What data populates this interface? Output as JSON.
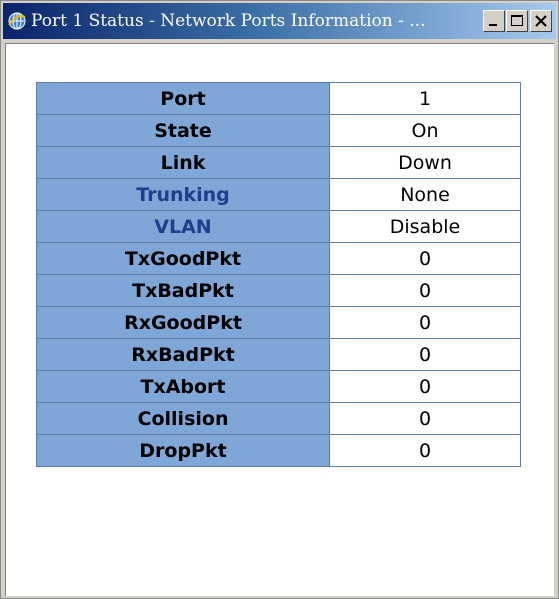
{
  "window": {
    "title": "Port 1 Status - Network Ports Information - ..."
  },
  "port_status": {
    "rows": [
      {
        "label": "Port",
        "value": "1"
      },
      {
        "label": "State",
        "value": "On"
      },
      {
        "label": "Link",
        "value": "Down"
      },
      {
        "label": "Trunking",
        "value": "None"
      },
      {
        "label": "VLAN",
        "value": "Disable"
      },
      {
        "label": "TxGoodPkt",
        "value": "0"
      },
      {
        "label": "TxBadPkt",
        "value": "0"
      },
      {
        "label": "RxGoodPkt",
        "value": "0"
      },
      {
        "label": "RxBadPkt",
        "value": "0"
      },
      {
        "label": "TxAbort",
        "value": "0"
      },
      {
        "label": "Collision",
        "value": "0"
      },
      {
        "label": "DropPkt",
        "value": "0"
      }
    ]
  },
  "colors": {
    "label_cell_bg": "#7ea7d8",
    "link_label_text": "#1d3f8c",
    "titlebar_start": "#0a246a",
    "titlebar_end": "#a6caf0"
  }
}
